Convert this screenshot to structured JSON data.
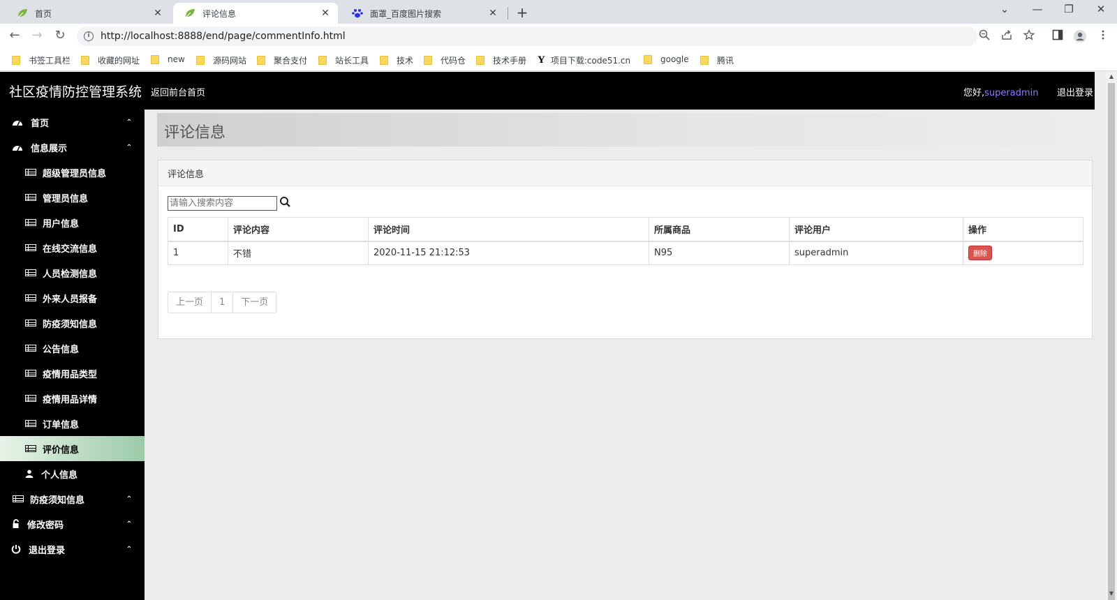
{
  "browser": {
    "tabs": [
      {
        "title": "首页",
        "close": "✕"
      },
      {
        "title": "评论信息",
        "close": "✕"
      },
      {
        "title": "面罩_百度图片搜索",
        "close": "✕"
      }
    ],
    "new_tab": "+",
    "window": {
      "chevron": "⌄",
      "minimize": "—",
      "restore": "❐",
      "close": "✕"
    },
    "url": "http://localhost:8888/end/page/commentInfo.html",
    "nav": {
      "back": "←",
      "forward": "→",
      "reload": "↻"
    },
    "bookmarks": [
      "书签工具栏",
      "收藏的网址",
      "new",
      "源码网站",
      "聚合支付",
      "站长工具",
      "技术",
      "代码仓",
      "技术手册",
      "项目下载:code51.cn",
      "google",
      "腾讯"
    ]
  },
  "header": {
    "brand": "社区疫情防控管理系统",
    "back_link": "返回前台首页",
    "greeting": "您好,",
    "username": "superadmin",
    "logout": "退出登录"
  },
  "sidebar": {
    "items": [
      {
        "label": "首页",
        "icon": "dashboard-icon",
        "chevron": "⌃"
      },
      {
        "label": "信息展示",
        "icon": "dashboard-icon",
        "chevron": "⌃"
      },
      {
        "label": "超级管理员信息",
        "icon": "table-icon"
      },
      {
        "label": "管理员信息",
        "icon": "table-icon"
      },
      {
        "label": "用户信息",
        "icon": "table-icon"
      },
      {
        "label": "在线交流信息",
        "icon": "table-icon"
      },
      {
        "label": "人员检测信息",
        "icon": "table-icon"
      },
      {
        "label": "外来人员报备",
        "icon": "table-icon"
      },
      {
        "label": "防疫须知信息",
        "icon": "table-icon"
      },
      {
        "label": "公告信息",
        "icon": "table-icon"
      },
      {
        "label": "疫情用品类型",
        "icon": "table-icon"
      },
      {
        "label": "疫情用品详情",
        "icon": "table-icon"
      },
      {
        "label": "订单信息",
        "icon": "table-icon"
      },
      {
        "label": "评价信息",
        "icon": "table-icon"
      },
      {
        "label": "个人信息",
        "icon": "user-icon"
      },
      {
        "label": "防疫须知信息",
        "icon": "table-icon",
        "chevron": "⌃"
      },
      {
        "label": "修改密码",
        "icon": "lock-icon",
        "chevron": "⌃"
      },
      {
        "label": "退出登录",
        "icon": "power-icon",
        "chevron": "⌃"
      }
    ]
  },
  "main": {
    "page_title": "评论信息",
    "panel_title": "评论信息",
    "search_placeholder": "请输入搜索内容",
    "table": {
      "headers": [
        "ID",
        "评论内容",
        "评论时间",
        "所属商品",
        "评论用户",
        "操作"
      ],
      "rows": [
        {
          "id": "1",
          "content": "不错",
          "time": "2020-11-15 21:12:53",
          "product": "N95",
          "user": "superadmin",
          "action": "删除"
        }
      ]
    },
    "pager": {
      "prev": "上一页",
      "page": "1",
      "next": "下一页"
    }
  },
  "colors": {
    "header_bg": "#000000",
    "username": "#8a7dff",
    "delete_button": "#d9534f",
    "active_item": "#9ccaa8"
  }
}
